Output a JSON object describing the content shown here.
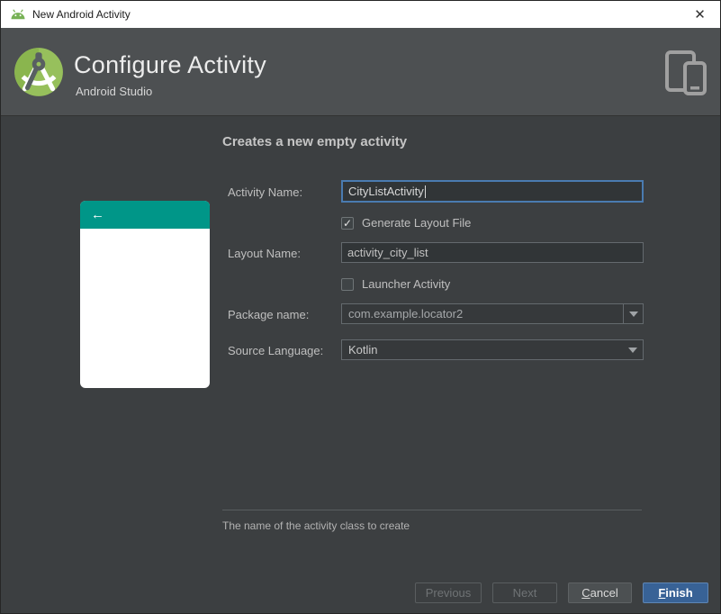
{
  "window": {
    "title": "New Android Activity",
    "close_icon": "✕"
  },
  "header": {
    "title": "Configure Activity",
    "subtitle": "Android Studio"
  },
  "content": {
    "heading": "Creates a new empty activity",
    "preview": {
      "back_icon": "←",
      "header_color": "#009688"
    },
    "form": {
      "activity_name": {
        "label": "Activity Name:",
        "value": "CityListActivity",
        "focused": true
      },
      "generate_layout": {
        "label": "Generate Layout File",
        "checked": true
      },
      "layout_name": {
        "label": "Layout Name:",
        "value": "activity_city_list"
      },
      "launcher_activity": {
        "label": "Launcher Activity",
        "checked": false
      },
      "package_name": {
        "label": "Package name:",
        "value": "com.example.locator2"
      },
      "source_language": {
        "label": "Source Language:",
        "value": "Kotlin"
      }
    },
    "hint": "The name of the activity class to create"
  },
  "footer": {
    "previous_label": "Previous",
    "next_label": "Next",
    "cancel": {
      "mnemonic": "C",
      "rest": "ancel"
    },
    "finish": {
      "mnemonic": "F",
      "rest": "inish"
    }
  },
  "icons": {
    "checkmark": "✓"
  },
  "colors": {
    "panel": "#3c3f41",
    "header_banner": "#4d5052",
    "teal_header": "#009688",
    "focus_blue": "#4a7bb0",
    "primary_button": "#386296",
    "android_green": "#97c05c"
  }
}
